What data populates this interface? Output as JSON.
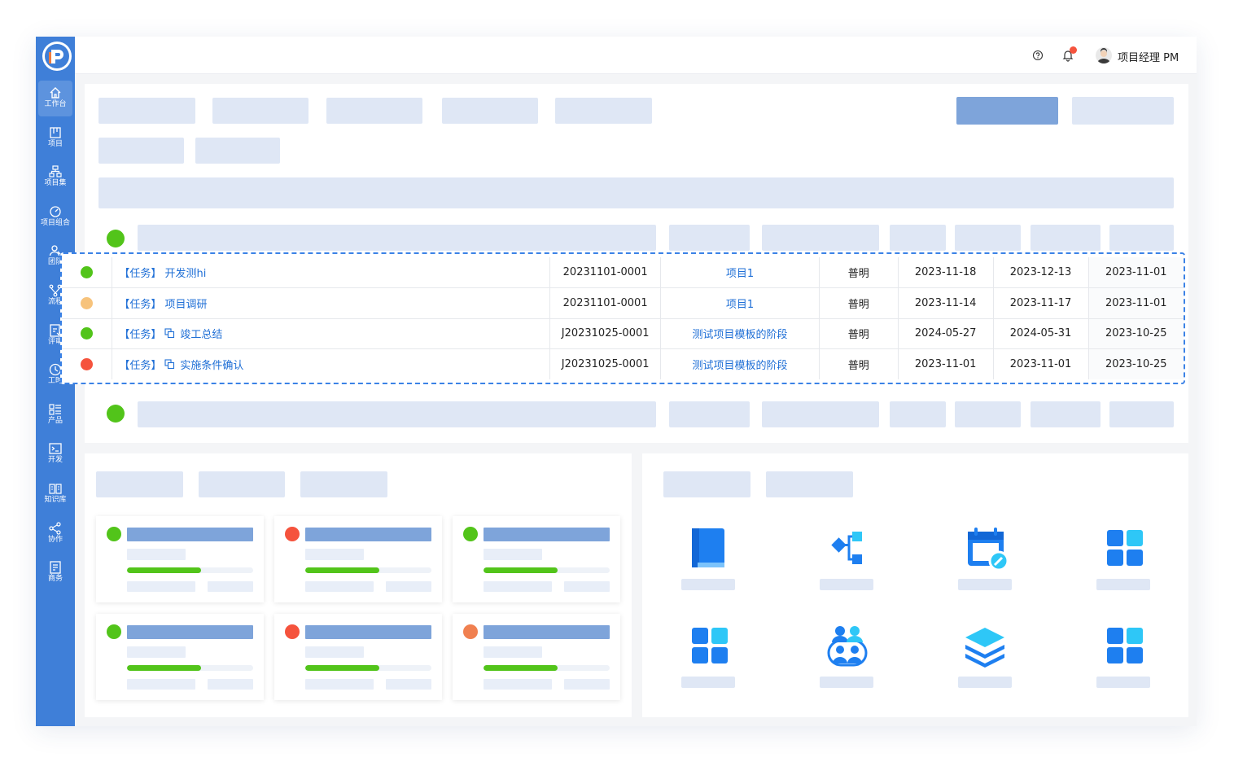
{
  "sidebar": {
    "items": [
      {
        "label": "工作台",
        "icon": "home-icon"
      },
      {
        "label": "项目",
        "icon": "kanban-icon"
      },
      {
        "label": "项目集",
        "icon": "hierarchy-icon"
      },
      {
        "label": "项目组合",
        "icon": "dashboard-icon"
      },
      {
        "label": "团队",
        "icon": "team-icon"
      },
      {
        "label": "流程",
        "icon": "flow-icon"
      },
      {
        "label": "评审",
        "icon": "review-icon"
      },
      {
        "label": "工时",
        "icon": "clock-icon"
      },
      {
        "label": "产品",
        "icon": "product-icon"
      },
      {
        "label": "开发",
        "icon": "terminal-icon"
      },
      {
        "label": "知识库",
        "icon": "book-icon"
      },
      {
        "label": "协作",
        "icon": "share-icon"
      },
      {
        "label": "商务",
        "icon": "business-icon"
      }
    ]
  },
  "header": {
    "user_name": "项目经理 PM",
    "help_icon": "help-icon",
    "bell_icon": "bell-icon"
  },
  "tasks": [
    {
      "status_color": "#52c41a",
      "prefix": "【任务】",
      "has_copy_icon": false,
      "name": "开发测hi",
      "code": "20231101-0001",
      "project": "项目1",
      "owner": "普明",
      "date1": "2023-11-18",
      "date2": "2023-12-13",
      "date3": "2023-11-01"
    },
    {
      "status_color": "#f7c37c",
      "prefix": "【任务】",
      "has_copy_icon": false,
      "name": "项目调研",
      "code": "20231101-0001",
      "project": "项目1",
      "owner": "普明",
      "date1": "2023-11-14",
      "date2": "2023-11-17",
      "date3": "2023-11-01"
    },
    {
      "status_color": "#52c41a",
      "prefix": "【任务】",
      "has_copy_icon": true,
      "name": "竣工总结",
      "code": "J20231025-0001",
      "project": "测试项目模板的阶段",
      "owner": "普明",
      "date1": "2024-05-27",
      "date2": "2024-05-31",
      "date3": "2023-10-25"
    },
    {
      "status_color": "#f5533d",
      "prefix": "【任务】",
      "has_copy_icon": true,
      "name": "实施条件确认",
      "code": "J20231025-0001",
      "project": "测试项目模板的阶段",
      "owner": "普明",
      "date1": "2023-11-01",
      "date2": "2023-11-01",
      "date3": "2023-10-25"
    }
  ],
  "project_cards": [
    {
      "status_color": "#52c41a",
      "progress": 0.59
    },
    {
      "status_color": "#f5533d",
      "progress": 0.59
    },
    {
      "status_color": "#52c41a",
      "progress": 0.59
    },
    {
      "status_color": "#52c41a",
      "progress": 0.59
    },
    {
      "status_color": "#f5533d",
      "progress": 0.59
    },
    {
      "status_color": "#f08050",
      "progress": 0.59
    }
  ],
  "apps": [
    "book-icon",
    "flowchart-icon",
    "calendar-edit-icon",
    "grid-apps-icon",
    "grid-apps-icon",
    "people-icon",
    "layers-icon",
    "grid-apps-icon"
  ],
  "colors": {
    "brand": "#3f7fd8",
    "link": "#1f6fd6",
    "green": "#52c41a",
    "orange": "#f7c37c",
    "red": "#f5533d"
  }
}
